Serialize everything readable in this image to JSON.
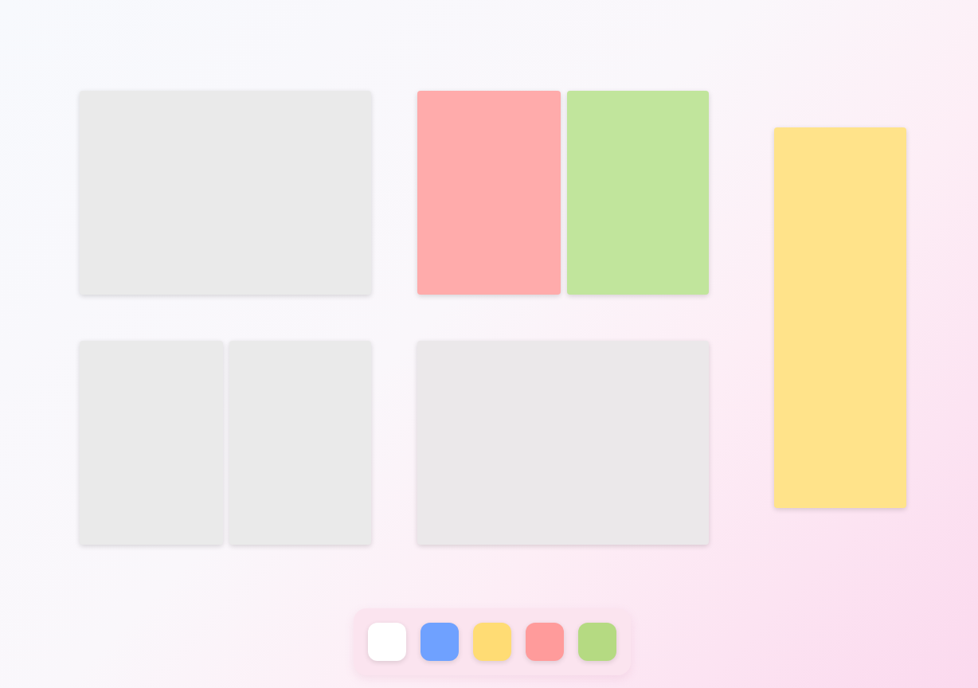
{
  "layouts": [
    {
      "panes": [
        {
          "color": "#eaeaea"
        }
      ]
    },
    {
      "panes": [
        {
          "color": "#ffabab"
        },
        {
          "color": "#c1e59c"
        }
      ]
    },
    {
      "panes": [
        {
          "color": "#eaeaea"
        },
        {
          "color": "#eaeaea"
        }
      ]
    },
    {
      "panes": [
        {
          "color": "#ebe8ea"
        }
      ]
    }
  ],
  "sticky_note": {
    "color": "#ffe38a"
  },
  "palette": [
    {
      "color": "#ffffff"
    },
    {
      "color": "#6fa1ff"
    },
    {
      "color": "#ffdc74"
    },
    {
      "color": "#ff9b9b"
    },
    {
      "color": "#b5da82"
    }
  ]
}
